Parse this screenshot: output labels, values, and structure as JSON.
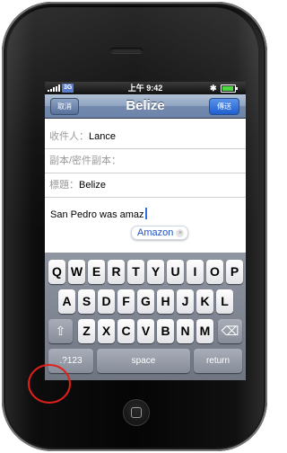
{
  "status_bar": {
    "network": "3G",
    "time": "上午 9:42",
    "bluetooth_icon": "bluetooth-icon",
    "battery_icon": "battery-icon",
    "battery_color": "#4cd640"
  },
  "nav": {
    "cancel_label": "取消",
    "title": "Belize",
    "send_label": "傳送",
    "send_color": "#1e5fd0"
  },
  "compose": {
    "to_label": "收件人：",
    "to_value": "Lance",
    "cc_label": "副本/密件副本：",
    "subject_label": "標題：",
    "subject_value": "Belize",
    "body_text": "San Pedro was amaz"
  },
  "autocorrect": {
    "suggestion": "Amazon",
    "dismiss_glyph": "×"
  },
  "keyboard": {
    "row1": [
      "Q",
      "W",
      "E",
      "R",
      "T",
      "Y",
      "U",
      "I",
      "O",
      "P"
    ],
    "row2": [
      "A",
      "S",
      "D",
      "F",
      "G",
      "H",
      "J",
      "K",
      "L"
    ],
    "row3": [
      "Z",
      "X",
      "C",
      "V",
      "B",
      "N",
      "M"
    ],
    "shift_glyph": "⇧",
    "delete_glyph": "⌫",
    "numbers_label": ".?123",
    "space_label": "space",
    "return_label": "return"
  },
  "annotation": {
    "ring_color": "#e0201a"
  }
}
